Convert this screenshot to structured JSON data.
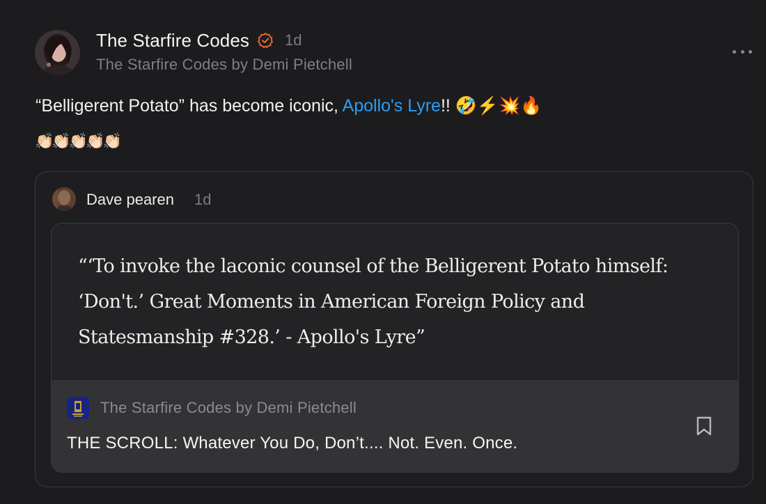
{
  "header": {
    "publication_name": "The Starfire Codes",
    "time_ago": "1d",
    "byline": "The Starfire Codes by Demi Pietchell",
    "verified_icon": "verified-check-icon",
    "more_icon": "ellipsis-icon",
    "verified_color": "#f26a2e"
  },
  "post": {
    "text_before": "“Belligerent Potato” has become iconic, ",
    "mention": "Apollo's Lyre",
    "text_after": "!! 🤣⚡💥🔥",
    "clap_emojis": "👏🏻👏🏻👏🏻👏🏻👏🏻",
    "mention_color": "#2f9cf3"
  },
  "quoted_note": {
    "author": "Dave pearen",
    "time_ago": "1d",
    "quote_text": "“‘To invoke the laconic counsel of the Belligerent Potato himself: ‘Don't.’ Great Moments in American Foreign Policy and Statesmanship #328.’ - Apollo's Lyre”",
    "source": {
      "publication": "The Starfire Codes by Demi Pietchell",
      "title": "THE SCROLL: Whatever You Do, Don’t.... Not. Even. Once.",
      "bookmark_icon": "bookmark-icon"
    }
  }
}
